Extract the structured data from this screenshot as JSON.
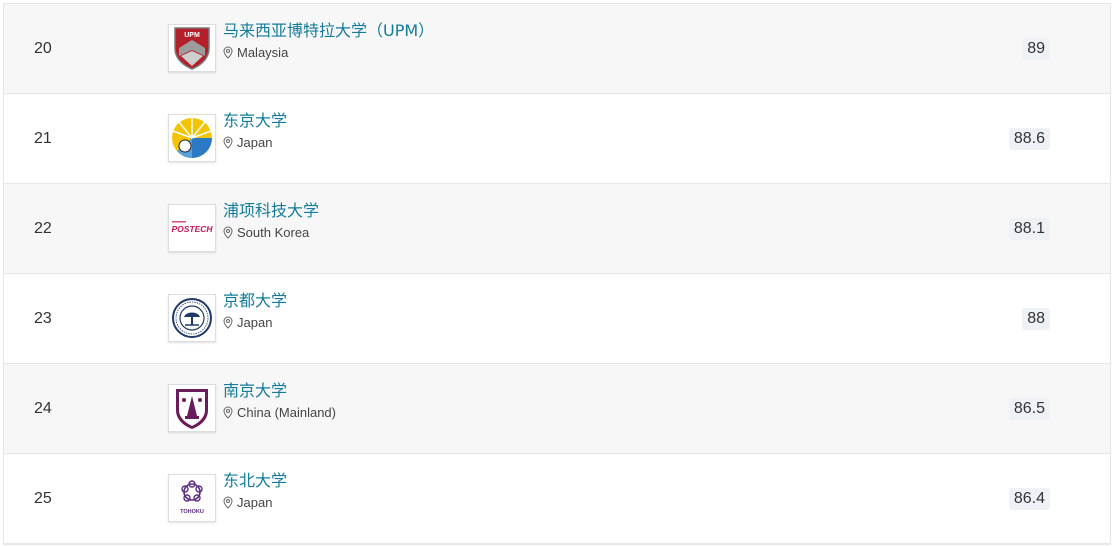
{
  "rows": [
    {
      "rank": "20",
      "name": "马来西亚博特拉大学（UPM）",
      "location": "Malaysia",
      "score": "89",
      "logo_text": "UPM",
      "logo_icon": "upm-logo-icon"
    },
    {
      "rank": "21",
      "name": "东京大学",
      "location": "Japan",
      "score": "88.6",
      "logo_text": "",
      "logo_icon": "ginkgo-leaf-logo-icon"
    },
    {
      "rank": "22",
      "name": "浦项科技大学",
      "location": "South Korea",
      "score": "88.1",
      "logo_text": "POSTECH",
      "logo_icon": "postech-logo-icon"
    },
    {
      "rank": "23",
      "name": "京都大学",
      "location": "Japan",
      "score": "88",
      "logo_text": "",
      "logo_icon": "kyoto-seal-logo-icon"
    },
    {
      "rank": "24",
      "name": "南京大学",
      "location": "China (Mainland)",
      "score": "86.5",
      "logo_text": "",
      "logo_icon": "nanjing-shield-logo-icon"
    },
    {
      "rank": "25",
      "name": "东北大学",
      "location": "Japan",
      "score": "86.4",
      "logo_text": "TOHOKU",
      "logo_icon": "tohoku-logo-icon"
    }
  ],
  "colors": {
    "link": "#137c9b",
    "alt_row": "#f7f7f7",
    "score_badge": "#eef1f6"
  }
}
